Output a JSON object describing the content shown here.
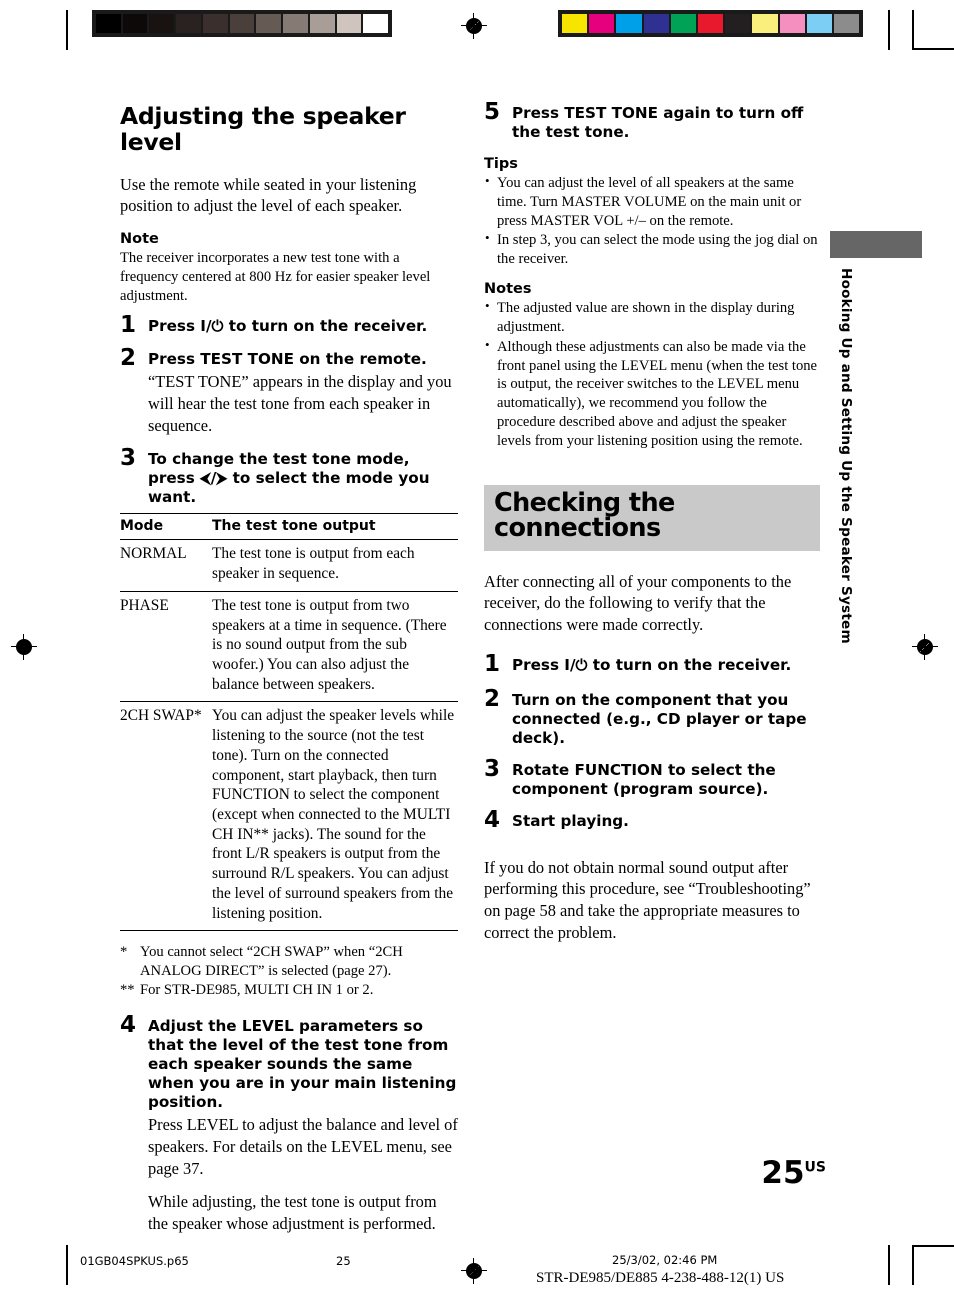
{
  "document": {
    "page_number": "25",
    "page_suffix": "US",
    "side_tab": "Hooking Up and Setting Up the Speaker System"
  },
  "footer": {
    "file_name": "01GB04SPKUS.p65",
    "page": "25",
    "timestamp": "25/3/02, 02:46 PM",
    "model": "STR-DE985/DE885    4-238-488-12(1) US"
  },
  "calibration": {
    "grayscale": [
      "#000000",
      "#0d0908",
      "#181311",
      "#2a2220",
      "#3a2f2c",
      "#4b3f3b",
      "#665a55",
      "#857a74",
      "#a89d97",
      "#cfc5be",
      "#ffffff"
    ],
    "colors": [
      "#f7e500",
      "#e6007e",
      "#00a0e9",
      "#2e3192",
      "#00a355",
      "#e8192c",
      "#231f20",
      "#faee7d",
      "#f48fc0",
      "#7dcef4",
      "#8c8c8c"
    ]
  },
  "left_column": {
    "title": "Adjusting the speaker level",
    "intro": "Use the remote while seated in your listening position to adjust the level of each speaker.",
    "note_label": "Note",
    "note_text": "The receiver incorporates a new test tone with a frequency centered at 800 Hz for easier speaker level adjustment.",
    "steps": [
      {
        "num": "1",
        "head": "Press I/⏻ to turn on the receiver.",
        "subs": []
      },
      {
        "num": "2",
        "head": "Press TEST TONE on the remote.",
        "subs": [
          "“TEST TONE” appears in the display and you will hear the test tone from each speaker in sequence."
        ]
      },
      {
        "num": "3",
        "head": "To change the test tone mode, press ⮜/⮞ to select the mode you want.",
        "subs": []
      }
    ],
    "table": {
      "headers": [
        "Mode",
        "The test tone output"
      ],
      "rows": [
        {
          "mode": "NORMAL",
          "output": "The test tone is output from each speaker in sequence."
        },
        {
          "mode": "PHASE",
          "output": "The test tone is output from two speakers at a time in sequence. (There is no sound output from the sub woofer.) You can also adjust the balance between speakers."
        },
        {
          "mode": "2CH SWAP*",
          "output": "You can adjust the speaker levels while listening to the source (not the test tone). Turn on the connected component, start playback, then turn FUNCTION to select the component (except when connected to the MULTI CH IN** jacks). The sound for the front L/R speakers is output from the surround R/L speakers. You can adjust the level of surround speakers from the listening position."
        }
      ]
    },
    "footnotes": [
      {
        "mark": "*",
        "text": "You cannot select “2CH SWAP” when “2CH ANALOG DIRECT” is selected (page 27)."
      },
      {
        "mark": "**",
        "text": "For STR-DE985, MULTI CH IN 1 or 2."
      }
    ],
    "step4": {
      "num": "4",
      "head": "Adjust the LEVEL parameters so that the level of the test tone from each speaker sounds the same when you are in your main listening position.",
      "subs": [
        "Press LEVEL to adjust the balance and level of speakers. For details on the LEVEL menu, see page 37.",
        "While adjusting, the test tone is output from the speaker whose adjustment is performed."
      ]
    }
  },
  "right_column": {
    "step5": {
      "num": "5",
      "head": "Press TEST TONE again to turn off the test tone."
    },
    "tips_label": "Tips",
    "tips": [
      "You can adjust the level of all speakers at the same time. Turn MASTER VOLUME on the main unit or press MASTER VOL +/– on the remote.",
      "In step 3, you can select the mode using the jog dial on the receiver."
    ],
    "notes_label": "Notes",
    "notes": [
      "The adjusted value are shown in the display during adjustment.",
      "Although these adjustments can also be made via the front panel using the LEVEL menu (when the test tone is output, the receiver switches to the LEVEL menu automatically), we recommend you follow the procedure described above and adjust the speaker levels from your listening position using the remote."
    ],
    "chapter_title": "Checking the connections",
    "chapter_intro": "After connecting all of your components to the receiver, do the following to verify that the connections were made correctly.",
    "steps": [
      {
        "num": "1",
        "head": "Press I/⏻ to turn on the receiver."
      },
      {
        "num": "2",
        "head": "Turn on the component that you connected (e.g., CD player or tape deck)."
      },
      {
        "num": "3",
        "head": "Rotate FUNCTION to select the component (program source)."
      },
      {
        "num": "4",
        "head": "Start playing."
      }
    ],
    "closing": "If you do not obtain normal sound output after performing this procedure, see “Troubleshooting” on page 58 and take the appropriate measures to correct the problem."
  }
}
